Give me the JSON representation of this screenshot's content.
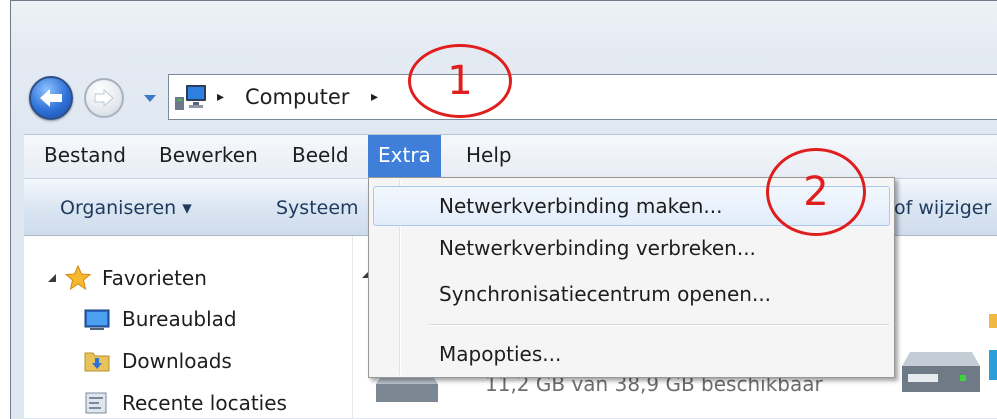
{
  "address_bar": {
    "path_segment": "Computer",
    "separator_glyph": "▸"
  },
  "annotations": {
    "circle_1": "1",
    "circle_2": "2"
  },
  "menubar": {
    "items": [
      "Bestand",
      "Bewerken",
      "Beeld",
      "Extra",
      "Help"
    ],
    "active": "Extra"
  },
  "toolbar": {
    "organise_label": "Organiseren ▾",
    "system_label": "Systeem",
    "change_label": "of wijziger"
  },
  "navigation_pane": {
    "favorites_label": "Favorieten",
    "items": [
      "Bureaublad",
      "Downloads",
      "Recente locaties"
    ]
  },
  "content": {
    "drive_free_text": "11,2 GB van 38,9 GB beschikbaar"
  },
  "extra_menu": {
    "items": [
      "Netwerkverbinding maken...",
      "Netwerkverbinding verbreken...",
      "Synchronisatiecentrum openen...",
      "Mapopties..."
    ],
    "highlighted_index": 0
  },
  "colors": {
    "menu_active_bg": "#3f7fd9",
    "annotation_red": "#e01e1e",
    "hover_border": "#a9c8ee"
  },
  "icons": {
    "back": "back-arrow-icon",
    "forward": "forward-arrow-icon",
    "computer": "computer-icon",
    "favorites": "star-icon",
    "desktop": "desktop-icon",
    "downloads": "downloads-folder-icon",
    "recent": "recent-places-icon",
    "drive": "hard-drive-icon"
  }
}
